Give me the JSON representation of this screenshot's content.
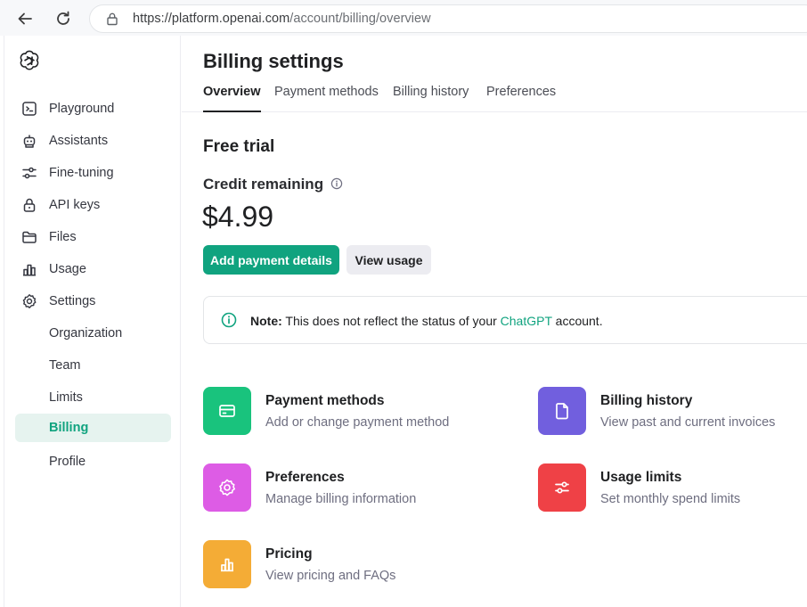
{
  "browser": {
    "url_host": "https://platform.openai.com",
    "url_path": "/account/billing/overview"
  },
  "sidebar": {
    "items": [
      {
        "label": "Playground",
        "icon": "terminal-icon"
      },
      {
        "label": "Assistants",
        "icon": "robot-icon"
      },
      {
        "label": "Fine-tuning",
        "icon": "sliders-icon"
      },
      {
        "label": "API keys",
        "icon": "lock-icon"
      },
      {
        "label": "Files",
        "icon": "folder-icon"
      },
      {
        "label": "Usage",
        "icon": "bar-chart-icon"
      },
      {
        "label": "Settings",
        "icon": "gear-icon"
      }
    ],
    "sub_items": [
      {
        "label": "Organization"
      },
      {
        "label": "Team"
      },
      {
        "label": "Limits"
      },
      {
        "label": "Billing",
        "active": true
      },
      {
        "label": "Profile"
      }
    ]
  },
  "header": {
    "title": "Billing settings",
    "tabs": [
      "Overview",
      "Payment methods",
      "Billing history",
      "Preferences"
    ],
    "active_tab": "Overview"
  },
  "overview": {
    "section_title": "Free trial",
    "credit_label": "Credit remaining",
    "credit_value": "$4.99",
    "add_payment_label": "Add payment details",
    "view_usage_label": "View usage",
    "note_prefix": "Note:",
    "note_text_1": " This does not reflect the status of your ",
    "note_link": "ChatGPT",
    "note_text_2": " account."
  },
  "cards": [
    {
      "title": "Payment methods",
      "desc": "Add or change payment method",
      "color": "#19c37d",
      "icon": "credit-card-icon"
    },
    {
      "title": "Billing history",
      "desc": "View past and current invoices",
      "color": "#715fde",
      "icon": "document-icon"
    },
    {
      "title": "Preferences",
      "desc": "Manage billing information",
      "color": "#dd5ce5",
      "icon": "gear-icon"
    },
    {
      "title": "Usage limits",
      "desc": "Set monthly spend limits",
      "color": "#ef4146",
      "icon": "sliders-icon"
    },
    {
      "title": "Pricing",
      "desc": "View pricing and FAQs",
      "color": "#f4ac36",
      "icon": "bar-chart-icon"
    }
  ],
  "colors": {
    "accent": "#10a37f",
    "active_bg": "#e6f3ef"
  }
}
